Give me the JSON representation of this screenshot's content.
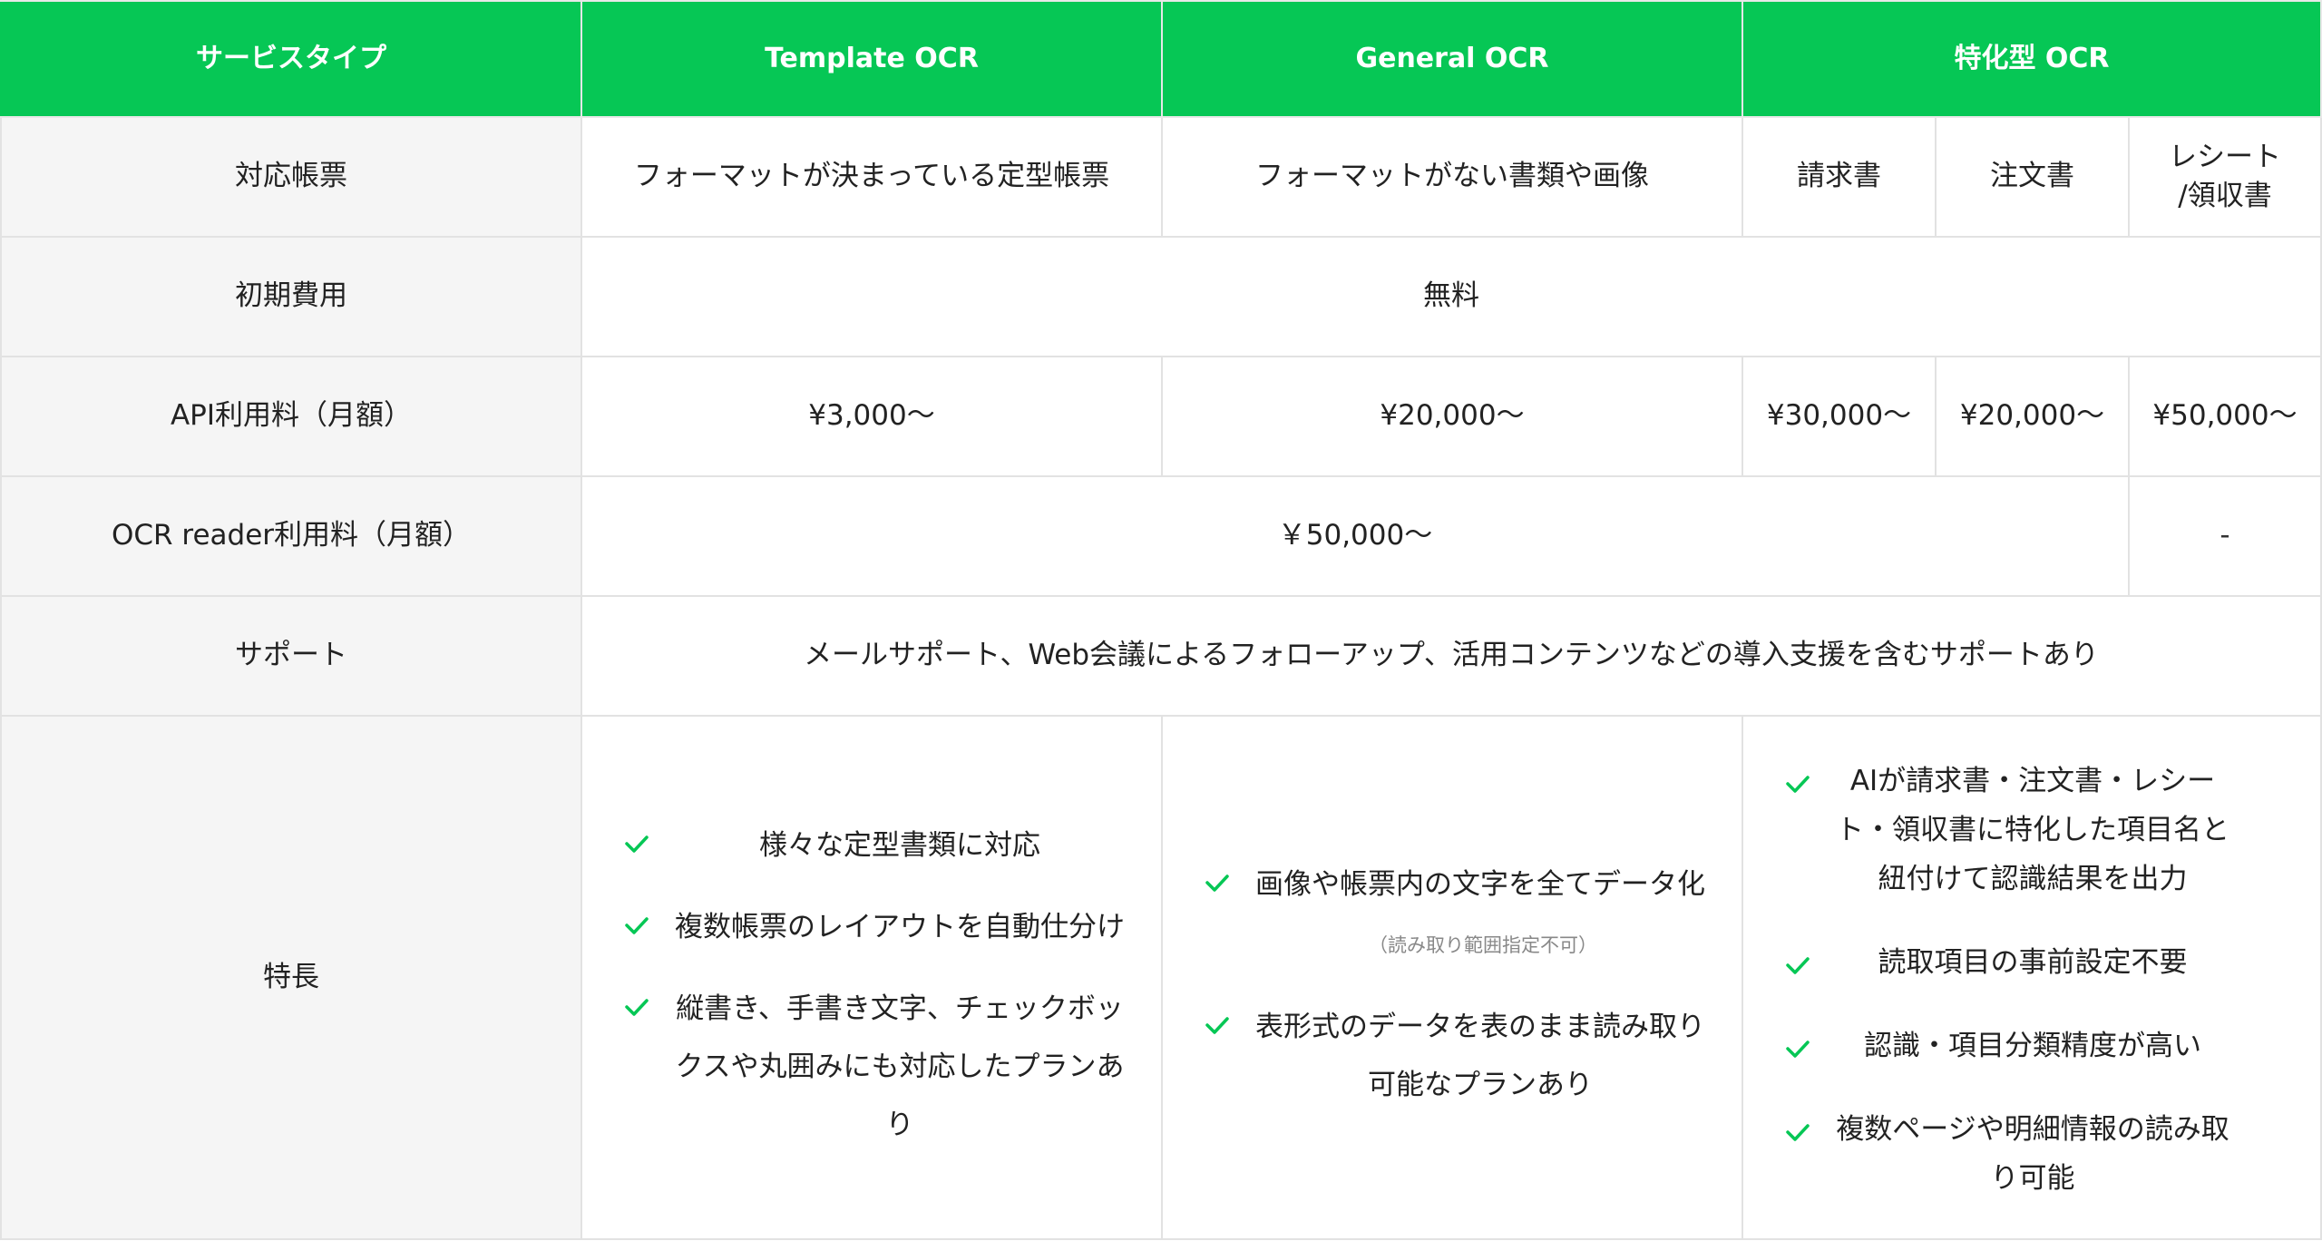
{
  "header": {
    "service_type": "サービスタイプ",
    "template_ocr": "Template OCR",
    "general_ocr": "General OCR",
    "specialized_ocr": "特化型 OCR"
  },
  "rows": {
    "documents": {
      "label": "対応帳票",
      "template": "フォーマットが決まっている定型帳票",
      "general": "フォーマットがない書類や画像",
      "invoice": "請求書",
      "order": "注文書",
      "receipt_line1": "レシート",
      "receipt_line2": "/領収書"
    },
    "initial_cost": {
      "label": "初期費用",
      "value": "無料"
    },
    "api_fee": {
      "label": "API利用料（月額）",
      "template": "¥3,000〜",
      "general": "¥20,000〜",
      "invoice": "¥30,000〜",
      "order": "¥20,000〜",
      "receipt": "¥50,000〜"
    },
    "reader_fee": {
      "label": "OCR reader利用料（月額）",
      "value": "￥50,000〜",
      "receipt": "-"
    },
    "support": {
      "label": "サポート",
      "value": "メールサポート、Web会議によるフォローアップ、活用コンテンツなどの導入支援を含むサポートあり"
    },
    "features": {
      "label": "特長",
      "template": [
        "様々な定型書類に対応",
        "複数帳票のレイアウトを自動仕分け",
        "縦書き、手書き文字、チェックボックスや丸囲みにも対応したプランあり"
      ],
      "general_item1_main": "画像や帳票内の文字を全てデータ化",
      "general_item1_note": "（読み取り範囲指定不可）",
      "general_item2": "表形式のデータを表のまま読み取り可能なプランあり",
      "specialized": [
        "AIが請求書・注文書・レシート・領収書に特化した項目名と紐付けて認識結果を出力",
        "読取項目の事前設定不要",
        "認識・項目分類精度が高い",
        "複数ページや明細情報の読み取り可能"
      ]
    }
  },
  "colors": {
    "header_green": "#06c755",
    "check_green": "#06c755",
    "row_head_bg": "#f5f5f5",
    "border": "#e2e2e2"
  },
  "icons": {
    "bullet": "check-icon"
  }
}
